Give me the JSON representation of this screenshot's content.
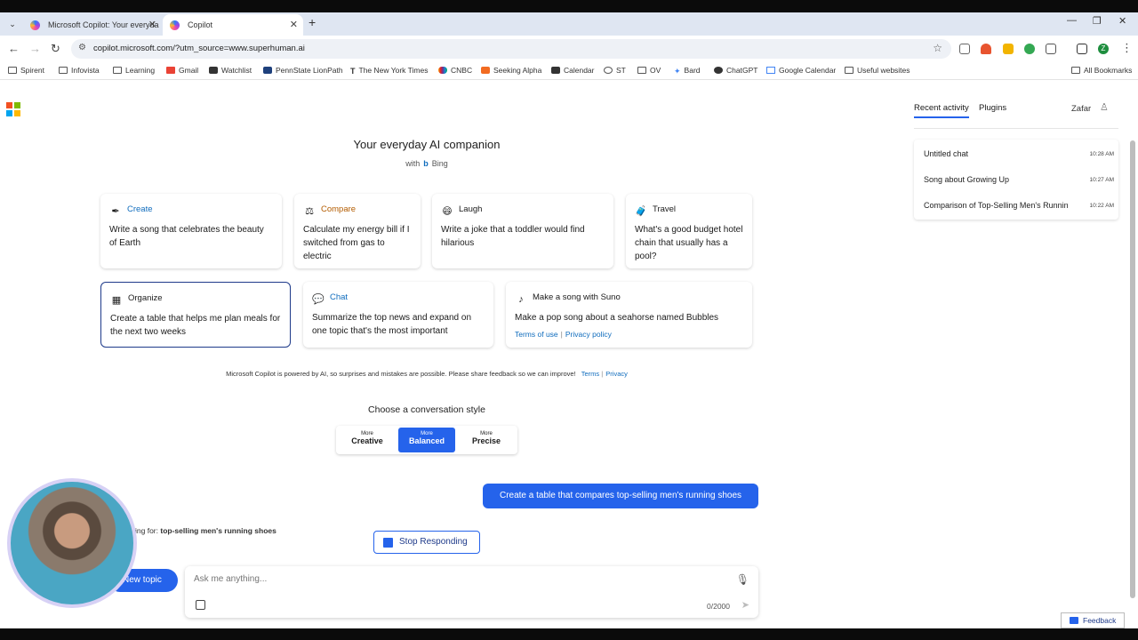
{
  "browser": {
    "tabs": [
      {
        "title": "Microsoft Copilot: Your everyda",
        "active": false
      },
      {
        "title": "Copilot",
        "active": true
      }
    ],
    "url": "copilot.microsoft.com/?utm_source=www.superhuman.ai",
    "profile_initial": "Z",
    "bookmarks": [
      "Spirent",
      "Infovista",
      "Learning",
      "Gmail",
      "Watchlist",
      "PennState LionPath",
      "The New York Times",
      "CNBC",
      "Seeking Alpha",
      "Calendar",
      "ST",
      "OV",
      "Bard",
      "ChatGPT",
      "Google Calendar",
      "Useful websites"
    ],
    "all_bookmarks": "All Bookmarks"
  },
  "hero": {
    "title": "Your everyday AI companion",
    "with": "with",
    "bing": "Bing"
  },
  "cards": [
    {
      "category": "Create",
      "text": "Write a song that celebrates the beauty of Earth",
      "color": "#0f6cbd",
      "icon": "magic-wand-icon"
    },
    {
      "category": "Compare",
      "text": "Calculate my energy bill if I switched from gas to electric",
      "color": "#b35c00",
      "icon": "scale-icon"
    },
    {
      "category": "Laugh",
      "text": "Write a joke that a toddler would find hilarious",
      "color": "#333333",
      "icon": "grin-icon"
    },
    {
      "category": "Travel",
      "text": "What's a good budget hotel chain that usually has a pool?",
      "color": "#333333",
      "icon": "luggage-icon"
    },
    {
      "category": "Organize",
      "text": "Create a table that helps me plan meals for the next two weeks",
      "color": "#333333",
      "icon": "organize-icon"
    },
    {
      "category": "Chat",
      "text": "Summarize the top news and expand on one topic that's the most important",
      "color": "#0f6cbd",
      "icon": "chat-icon"
    },
    {
      "category": "Make a song with Suno",
      "text": "Make a pop song about a seahorse named Bubbles",
      "color": "#333333",
      "icon": "suno-icon",
      "links": [
        "Terms of use",
        "Privacy policy"
      ]
    }
  ],
  "disclaimer": {
    "text": "Microsoft Copilot is powered by AI, so surprises and mistakes are possible. Please share feedback so we can improve!",
    "terms": "Terms",
    "privacy": "Privacy"
  },
  "conversation_style": {
    "title": "Choose a conversation style",
    "options": [
      {
        "small": "More",
        "label": "Creative"
      },
      {
        "small": "More",
        "label": "Balanced"
      },
      {
        "small": "More",
        "label": "Precise"
      }
    ],
    "selected": "Balanced"
  },
  "chat": {
    "user_message": "Create a table that compares top-selling men's running shoes",
    "search_prefix": "ing for:",
    "search_query": "top-selling men's running shoes",
    "stop_label": "Stop Responding"
  },
  "composer": {
    "new_topic": "New topic",
    "placeholder": "Ask me anything...",
    "char_count": "0/2000"
  },
  "right_panel": {
    "tabs": [
      "Recent activity",
      "Plugins"
    ],
    "user": "Zafar",
    "recent": [
      {
        "title": "Untitled chat",
        "time": "10:28 AM"
      },
      {
        "title": "Song about Growing Up",
        "time": "10:27 AM"
      },
      {
        "title": "Comparison of Top-Selling Men's Runnin",
        "time": "10:22 AM"
      }
    ]
  },
  "feedback_label": "Feedback",
  "colors": {
    "accent": "#2563eb",
    "link": "#0f6cbd"
  }
}
